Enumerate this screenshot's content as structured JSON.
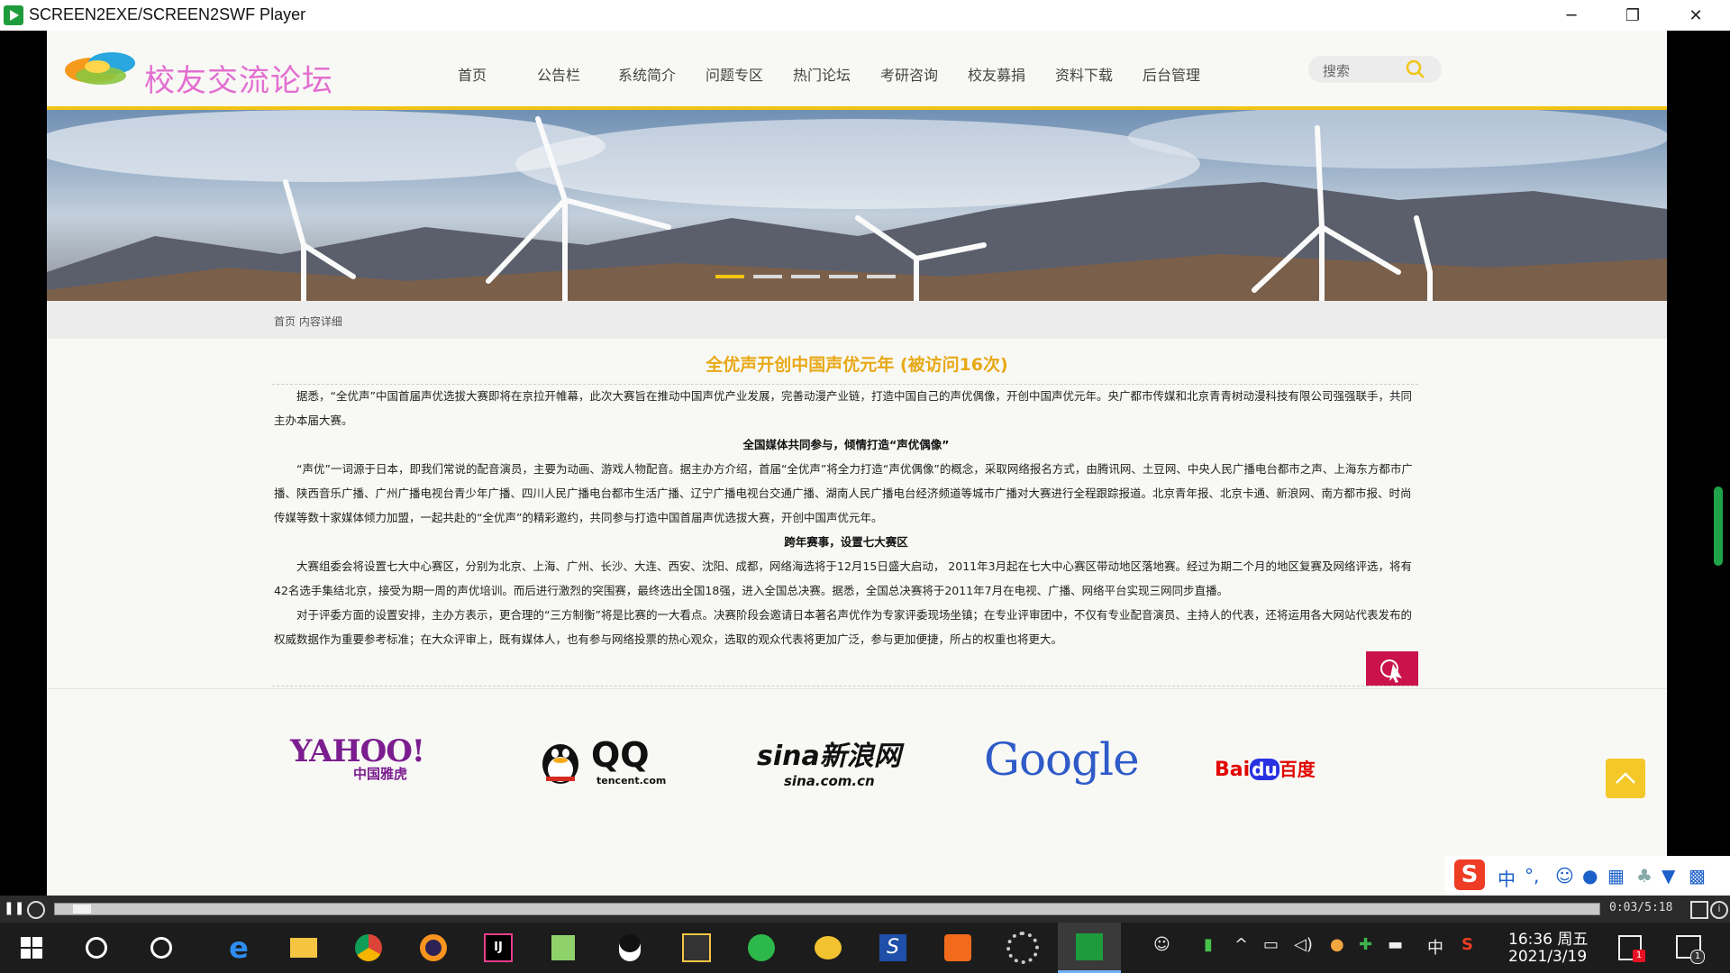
{
  "window": {
    "title": "SCREEN2EXE/SCREEN2SWF Player",
    "minimize": "─",
    "restore": "❐",
    "close": "✕"
  },
  "site": {
    "logo_text": "校友交流论坛",
    "nav": [
      "首页",
      "公告栏",
      "系统简介",
      "问题专区",
      "热门论坛",
      "考研咨询",
      "校友募捐",
      "资料下载",
      "后台管理"
    ],
    "search_placeholder": "搜索",
    "breadcrumb": "首页 内容详细",
    "carousel_dots": 5,
    "carousel_active": 0
  },
  "article": {
    "title": "全优声开创中国声优元年 (被访问16次)",
    "p1": "据悉，“全优声”中国首届声优选拔大赛即将在京拉开帷幕，此次大赛旨在推动中国声优产业发展，完善动漫产业链，打造中国自己的声优偶像，开创中国声优元年。央广都市传媒和北京青青树动漫科技有限公司强强联手，共同主办本届大赛。",
    "h1": "全国媒体共同参与，倾情打造“声优偶像”",
    "p2": "“声优”一词源于日本，即我们常说的配音演员，主要为动画、游戏人物配音。据主办方介绍，首届“全优声”将全力打造“声优偶像”的概念，采取网络报名方式，由腾讯网、土豆网、中央人民广播电台都市之声、上海东方都市广播、陕西音乐广播、广州广播电视台青少年广播、四川人民广播电台都市生活广播、辽宁广播电视台交通广播、湖南人民广播电台经济频道等城市广播对大赛进行全程跟踪报道。北京青年报、北京卡通、新浪网、南方都市报、时尚传媒等数十家媒体倾力加盟，一起共赴的“全优声”的精彩邀约，共同参与打造中国首届声优选拔大赛，开创中国声优元年。",
    "h2": "跨年赛事，设置七大赛区",
    "p3": "大赛组委会将设置七大中心赛区，分别为北京、上海、广州、长沙、大连、西安、沈阳、成都，网络海选将于12月15日盛大启动， 2011年3月起在七大中心赛区带动地区落地赛。经过为期二个月的地区复赛及网络评选，将有42名选手集结北京，接受为期一周的声优培训。而后进行激烈的突围赛，最终选出全国18强，进入全国总决赛。据悉，全国总决赛将于2011年7月在电视、广播、网络平台实现三网同步直播。",
    "p4": "对于评委方面的设置安排，主办方表示，更合理的“三方制衡”将是比赛的一大看点。决赛阶段会邀请日本著名声优作为专家评委现场坐镇；在专业评审团中，不仅有专业配音演员、主持人的代表，还将运用各大网站代表发布的权威数据作为重要参考标准；在大众评审上，既有媒体人，也有参与网络投票的热心观众，选取的观众代表将更加广泛，参与更加便捷，所占的权重也将更大。"
  },
  "partners": {
    "yahoo": "YAHOO!",
    "yahoo_cn": "中国雅虎",
    "qq": "QQ",
    "qq_sub": "tencent.com",
    "sina": "sina新浪网",
    "sina_sub": "sina.com.cn",
    "google": "Google",
    "baidu": "Bai",
    "baidu_du": "du",
    "baidu_cn": "百度"
  },
  "ime": {
    "logo": "S",
    "lang": "中",
    "punct": "°,"
  },
  "player": {
    "time": "0:03/5:18"
  },
  "taskbar": {
    "clock_time": "16:36 周五",
    "clock_date": "2021/3/19",
    "ime_lang": "中",
    "notif_count": "1",
    "action_count": "1"
  },
  "colors": {
    "accent_yellow": "#f2c414",
    "title_orange": "#e8a817",
    "logo_pink": "#e36fd0",
    "share_red": "#c9134a"
  }
}
